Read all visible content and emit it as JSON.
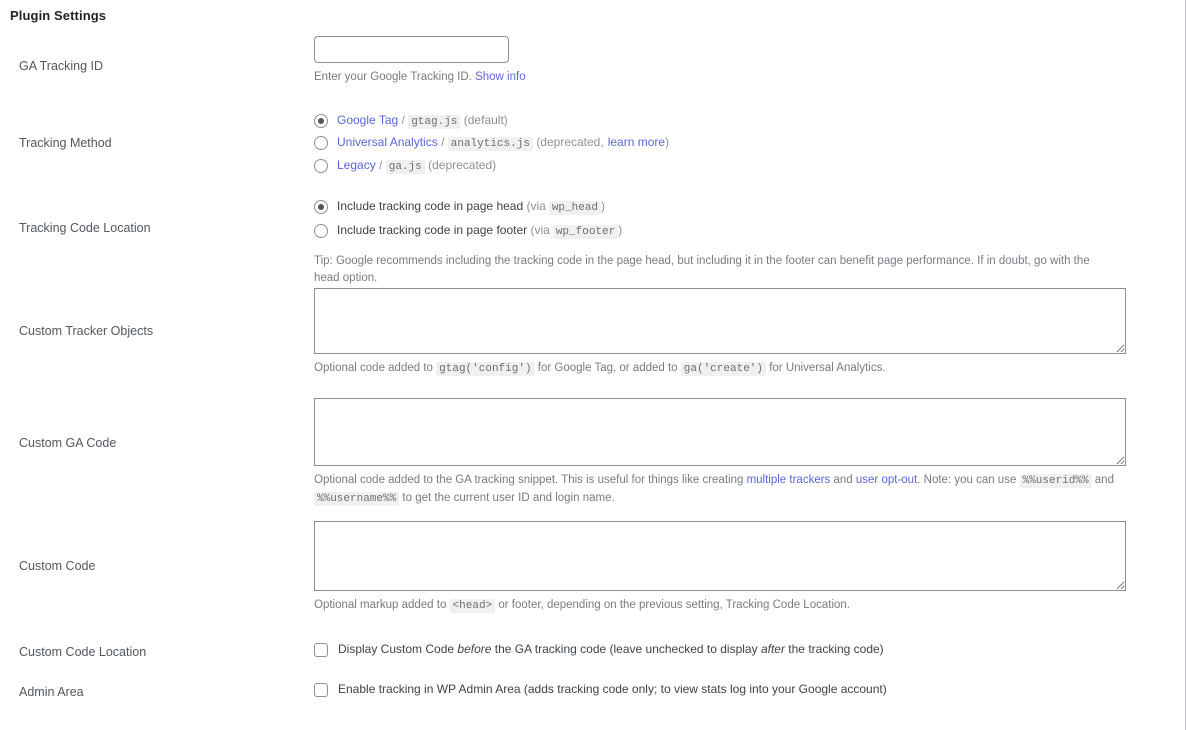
{
  "page": {
    "title": "Plugin Settings"
  },
  "rows": {
    "ga_tracking_id": {
      "label": "GA Tracking ID",
      "input_value": "",
      "input_placeholder": "",
      "desc_prefix": "Enter your Google Tracking ID.",
      "show_info_link": "Show info"
    },
    "tracking_method": {
      "label": "Tracking Method",
      "options": [
        {
          "name": "Google Tag",
          "sep": "/",
          "code": "gtag.js",
          "note_open": "(default)",
          "checked": true
        },
        {
          "name": "Universal Analytics",
          "sep": "/",
          "code": "analytics.js",
          "note_open": "(deprecated,",
          "note_link": "learn more",
          "note_close": ")",
          "checked": false
        },
        {
          "name": "Legacy",
          "sep": "/",
          "code": "ga.js",
          "note_open": "(deprecated)",
          "checked": false
        }
      ]
    },
    "tracking_code_location": {
      "label": "Tracking Code Location",
      "options": [
        {
          "text_before": "Include tracking code in page head",
          "paren_open": "(via",
          "code": "wp_head",
          "paren_close": ")",
          "checked": true
        },
        {
          "text_before": "Include tracking code in page footer",
          "paren_open": "(via",
          "code": "wp_footer",
          "paren_close": ")",
          "checked": false
        }
      ],
      "tip": "Tip: Google recommends including the tracking code in the page head, but including it in the footer can benefit page performance. If in doubt, go with the head option."
    },
    "custom_tracker_objects": {
      "label": "Custom Tracker Objects",
      "textarea_value": "",
      "desc_part1": "Optional code added to",
      "desc_code1": "gtag('config')",
      "desc_part2": "for Google Tag, or added to",
      "desc_code2": "ga('create')",
      "desc_part3": "for Universal Analytics."
    },
    "custom_ga_code": {
      "label": "Custom GA Code",
      "textarea_value": "",
      "desc_part1": "Optional code added to the GA tracking snippet. This is useful for things like creating",
      "desc_link1": "multiple trackers",
      "desc_part2": "and",
      "desc_link2": "user opt-out",
      "desc_part3": ". Note: you can use",
      "desc_code1": "%%userid%%",
      "desc_part4": "and",
      "desc_code2": "%%username%%",
      "desc_part5": "to get the current user ID and login name."
    },
    "custom_code": {
      "label": "Custom Code",
      "textarea_value": "",
      "desc_part1": "Optional markup added to",
      "desc_code1": "<head>",
      "desc_part2": "or footer, depending on the previous setting, Tracking Code Location."
    },
    "custom_code_location": {
      "label": "Custom Code Location",
      "checkbox_checked": false,
      "text_part1": "Display Custom Code",
      "text_em1": "before",
      "text_part2": "the GA tracking code (leave unchecked to display",
      "text_em2": "after",
      "text_part3": "the tracking code)"
    },
    "admin_area": {
      "label": "Admin Area",
      "checkbox_checked": false,
      "text": "Enable tracking in WP Admin Area (adds tracking code only; to view stats log into your Google account)"
    }
  },
  "colors": {
    "link": "#5a67d8",
    "label": "#51585e",
    "description": "#787c82",
    "code_bg": "#f0f0f1"
  }
}
